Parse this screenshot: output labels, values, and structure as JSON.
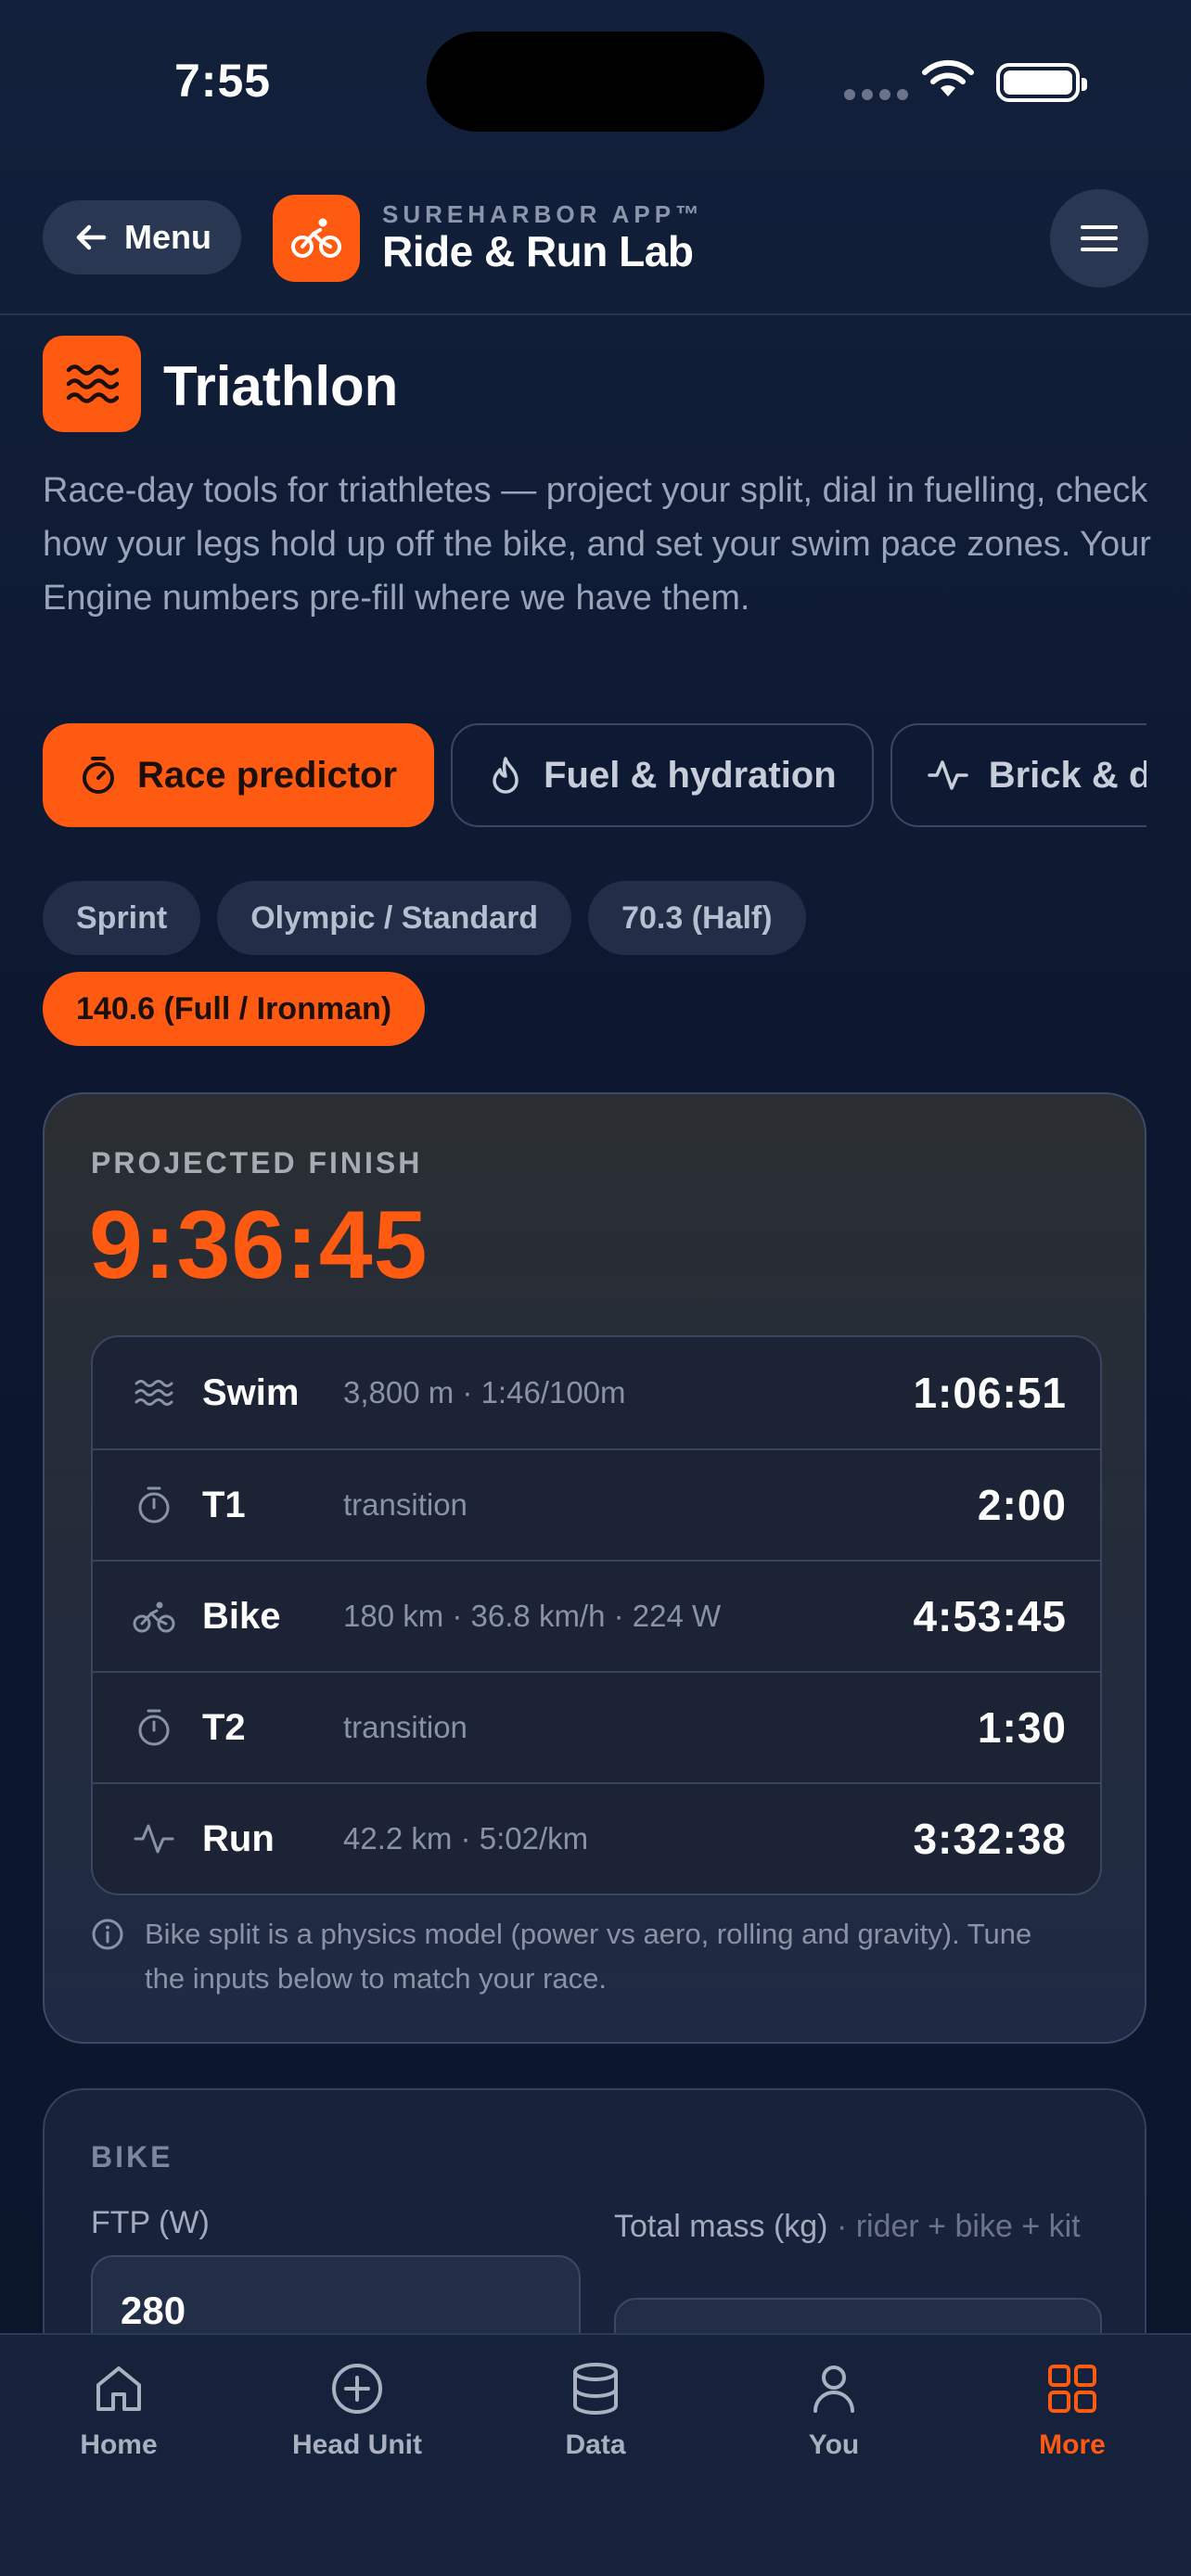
{
  "status_bar": {
    "time": "7:55"
  },
  "header": {
    "menu_label": "Menu",
    "brand_subtitle": "SUREHARBOR APP™",
    "brand_title": "Ride & Run Lab"
  },
  "page": {
    "title": "Triathlon",
    "intro": "Race-day tools for triathletes — project your split, dial in fuelling, check how your legs hold up off the bike, and set your swim pace zones. Your Engine numbers pre-fill where we have them."
  },
  "tool_tabs": [
    {
      "label": "Race predictor",
      "icon": "stopwatch-icon",
      "active": true
    },
    {
      "label": "Fuel & hydration",
      "icon": "flame-icon",
      "active": false
    },
    {
      "label": "Brick & decoupling",
      "icon": "activity-icon",
      "active": false
    }
  ],
  "distances": [
    {
      "label": "Sprint",
      "active": false
    },
    {
      "label": "Olympic / Standard",
      "active": false
    },
    {
      "label": "70.3 (Half)",
      "active": false
    },
    {
      "label": "140.6 (Full / Ironman)",
      "active": true
    }
  ],
  "projection": {
    "label": "PROJECTED FINISH",
    "finish_time": "9:36:45",
    "splits": [
      {
        "name": "Swim",
        "icon": "waves-icon",
        "detail": "3,800 m · 1:46/100m",
        "time": "1:06:51"
      },
      {
        "name": "T1",
        "icon": "stopwatch-icon",
        "detail": "transition",
        "time": "2:00"
      },
      {
        "name": "Bike",
        "icon": "bike-icon",
        "detail": "180 km · 36.8 km/h · 224 W",
        "time": "4:53:45"
      },
      {
        "name": "T2",
        "icon": "stopwatch-icon",
        "detail": "transition",
        "time": "1:30"
      },
      {
        "name": "Run",
        "icon": "activity-icon",
        "detail": "42.2 km · 5:02/km",
        "time": "3:32:38"
      }
    ],
    "note": "Bike split is a physics model (power vs aero, rolling and gravity). Tune the inputs below to match your race."
  },
  "bike": {
    "section_label": "BIKE",
    "ftp_label": "FTP (W)",
    "ftp_value": "280",
    "mass_label": "Total mass (kg)",
    "mass_hint": "· rider + bike + kit"
  },
  "nav": [
    {
      "label": "Home",
      "icon": "home-icon",
      "active": false
    },
    {
      "label": "Head Unit",
      "icon": "plus-circle-icon",
      "active": false
    },
    {
      "label": "Data",
      "icon": "database-icon",
      "active": false
    },
    {
      "label": "You",
      "icon": "user-icon",
      "active": false
    },
    {
      "label": "More",
      "icon": "grid-icon",
      "active": true
    }
  ],
  "colors": {
    "accent": "#ff5a12",
    "background": "#0f1a30",
    "card": "#1b2335",
    "muted_text": "#8a93a5"
  }
}
